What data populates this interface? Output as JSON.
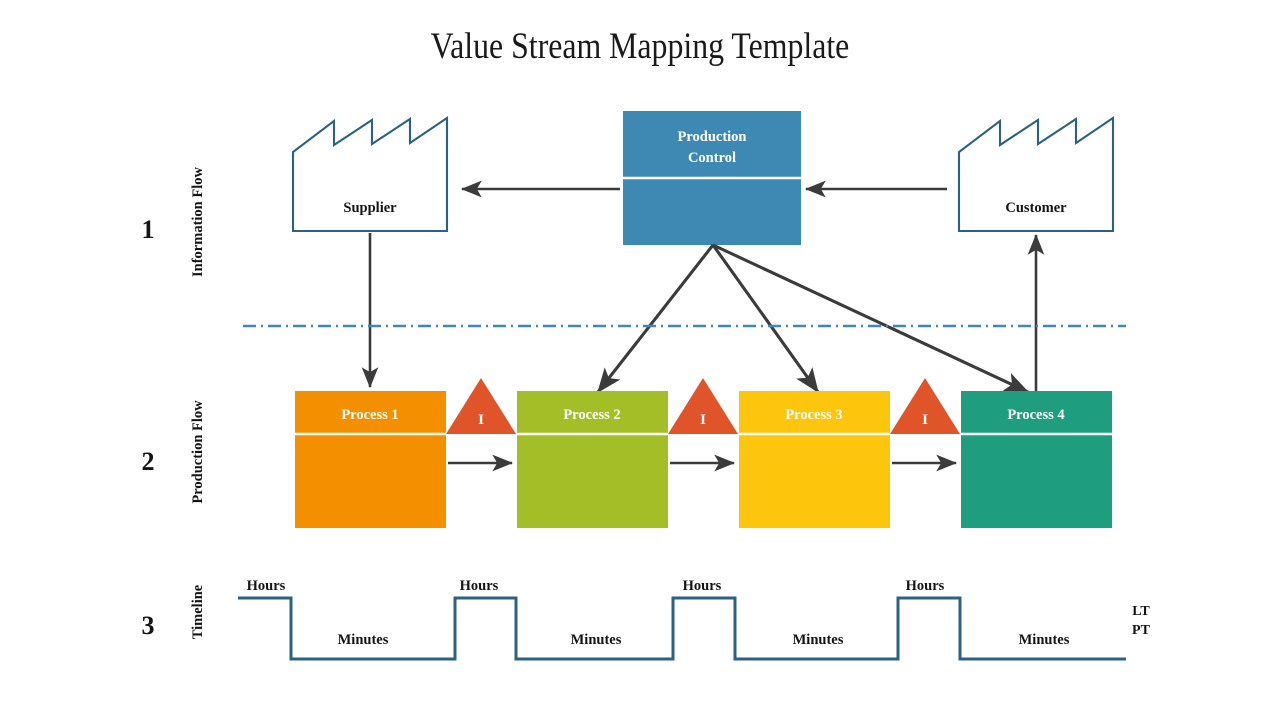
{
  "page": {
    "title": "Value Stream Mapping Template",
    "background": "#ffffff"
  },
  "colors": {
    "info_blue": "#3e88b4",
    "outline_blue": "#2c6182",
    "arrow_dark": "#3b3b3b",
    "process_1": "#f49000",
    "process_2": "#a4be28",
    "process_3": "#fdc50c",
    "process_4": "#1f9e7f",
    "inventory_red": "#df5428",
    "text_dark": "#141414",
    "text_light": "#ffffff"
  },
  "rows": [
    {
      "number": "1",
      "label": "Information Flow"
    },
    {
      "number": "2",
      "label": "Production Flow"
    },
    {
      "number": "3",
      "label": "Timeline"
    }
  ],
  "information_flow": {
    "supplier": {
      "label": "Supplier"
    },
    "customer": {
      "label": "Customer"
    },
    "production_control": {
      "line1": "Production",
      "line2": "Control"
    }
  },
  "production_flow": {
    "processes": [
      {
        "label": "Process 1",
        "color": "#f49000"
      },
      {
        "label": "Process 2",
        "color": "#a4be28"
      },
      {
        "label": "Process 3",
        "color": "#fdc50c"
      },
      {
        "label": "Process 4",
        "color": "#1f9e7f"
      }
    ],
    "inventories": [
      {
        "label": "I"
      },
      {
        "label": "I"
      },
      {
        "label": "I"
      }
    ]
  },
  "timeline": {
    "hours": [
      "Hours",
      "Hours",
      "Hours",
      "Hours"
    ],
    "minutes": [
      "Minutes",
      "Minutes",
      "Minutes",
      "Minutes"
    ],
    "metrics": {
      "lead_time": "LT",
      "process_time": "PT"
    }
  }
}
